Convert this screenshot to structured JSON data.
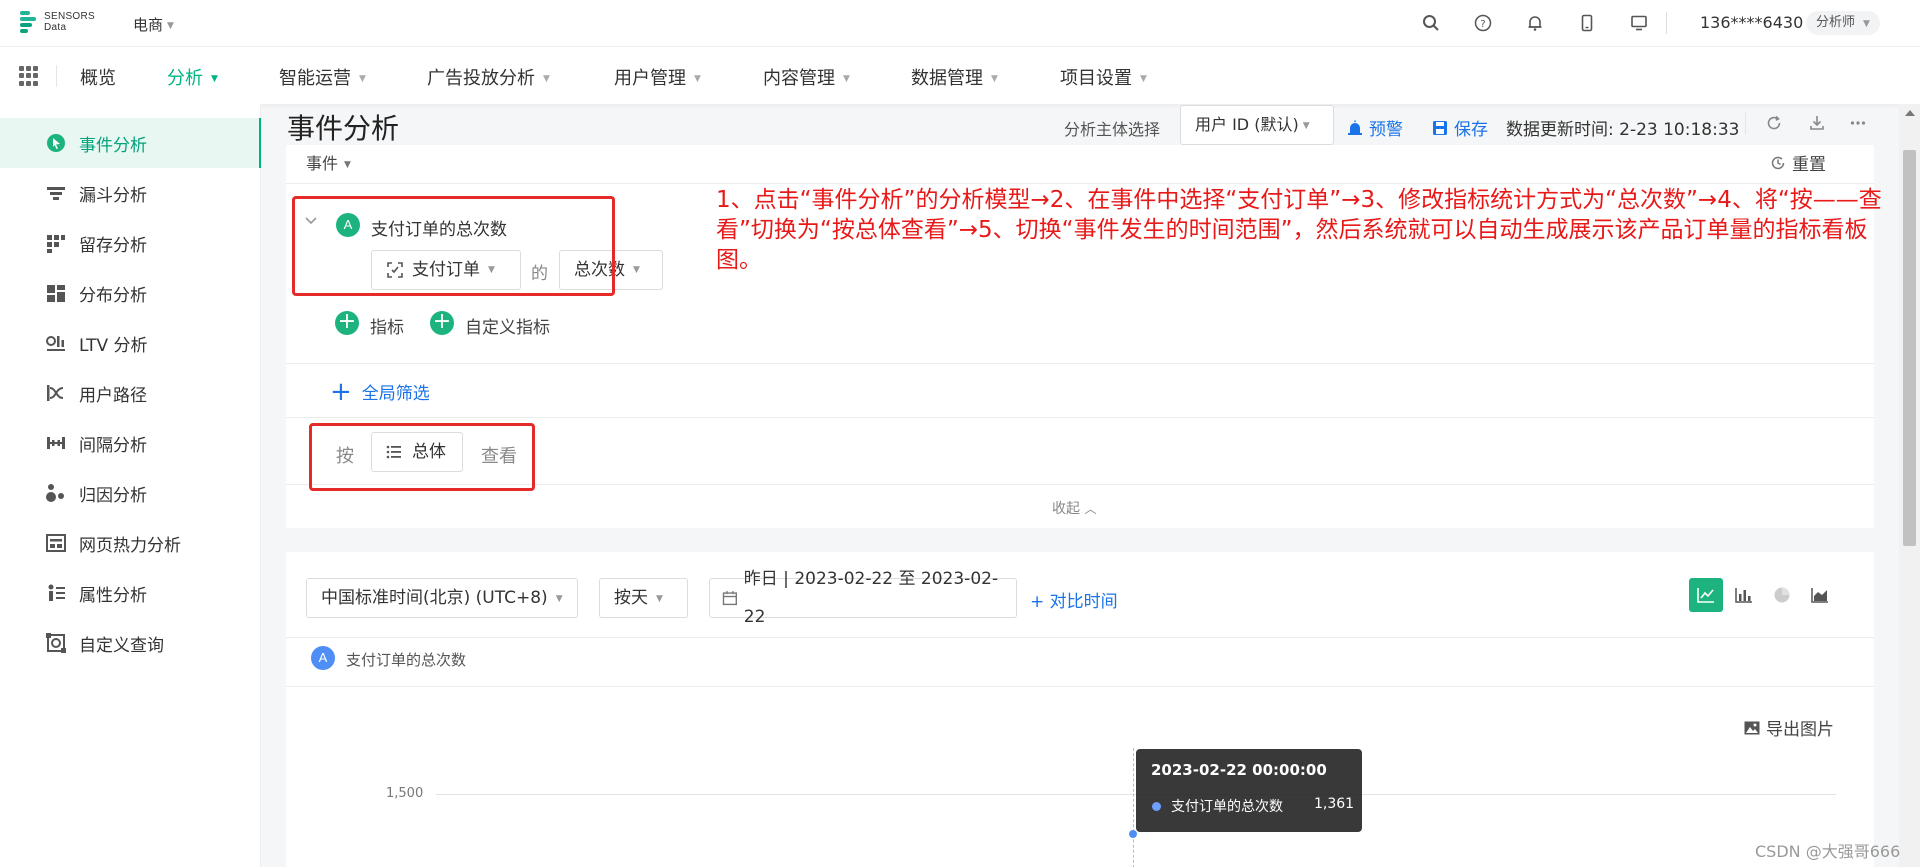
{
  "topbar": {
    "logo_line1": "SENSORS",
    "logo_line2": "Data",
    "project": "电商",
    "user_phone": "136****6430",
    "role": "分析师",
    "icons": [
      "search-icon",
      "help-icon",
      "bell-icon",
      "mobile-icon",
      "monitor-icon"
    ]
  },
  "nav": {
    "items": [
      {
        "label": "概览",
        "active": false,
        "dropdown": false
      },
      {
        "label": "分析",
        "active": true,
        "dropdown": true
      },
      {
        "label": "智能运营",
        "active": false,
        "dropdown": true
      },
      {
        "label": "广告投放分析",
        "active": false,
        "dropdown": true
      },
      {
        "label": "用户管理",
        "active": false,
        "dropdown": true
      },
      {
        "label": "内容管理",
        "active": false,
        "dropdown": true
      },
      {
        "label": "数据管理",
        "active": false,
        "dropdown": true
      },
      {
        "label": "项目设置",
        "active": false,
        "dropdown": true
      }
    ]
  },
  "sidebar": {
    "items": [
      {
        "label": "事件分析",
        "icon": "event-analysis-icon",
        "active": true
      },
      {
        "label": "漏斗分析",
        "icon": "funnel-icon",
        "active": false
      },
      {
        "label": "留存分析",
        "icon": "retention-icon",
        "active": false
      },
      {
        "label": "分布分析",
        "icon": "distribution-icon",
        "active": false
      },
      {
        "label": "LTV 分析",
        "icon": "ltv-icon",
        "active": false
      },
      {
        "label": "用户路径",
        "icon": "user-path-icon",
        "active": false
      },
      {
        "label": "间隔分析",
        "icon": "interval-icon",
        "active": false
      },
      {
        "label": "归因分析",
        "icon": "attribution-icon",
        "active": false
      },
      {
        "label": "网页热力分析",
        "icon": "heatmap-icon",
        "active": false
      },
      {
        "label": "属性分析",
        "icon": "attribute-icon",
        "active": false
      },
      {
        "label": "自定义查询",
        "icon": "custom-query-icon",
        "active": false
      }
    ]
  },
  "header": {
    "title": "事件分析",
    "subject_label": "分析主体选择",
    "subject_value": "用户 ID (默认)",
    "alert_label": "预警",
    "save_label": "保存",
    "update_time": "数据更新时间: 2-23 10:18:33"
  },
  "query": {
    "event_label": "事件",
    "reset_label": "重置",
    "metric_badge": "A",
    "metric_name": "支付订单的总次数",
    "event_select": "支付订单",
    "de_label": "的",
    "stat_select": "总次数",
    "add_metric": "指标",
    "add_custom_metric": "自定义指标",
    "global_filter": "全局筛选",
    "by_label": "按",
    "group_select": "总体",
    "view_label": "查看",
    "collapse_label": "收起"
  },
  "annotation": "1、点击“事件分析”的分析模型→2、在事件中选择“支付订单”→3、修改指标统计方式为“总次数”→4、将“按——查看”切换为“按总体查看”→5、切换“事件发生的时间范围”，然后系统就可以自动生成展示该产品订单量的指标看板图。",
  "chart_controls": {
    "timezone": "中国标准时间(北京) (UTC+8)",
    "granularity": "按天",
    "date_range": "昨日 | 2023-02-22 至 2023-02-22",
    "compare_label": "+ 对比时间",
    "chart_types": [
      "line-chart-icon",
      "bar-chart-icon",
      "pie-chart-icon",
      "area-chart-icon"
    ],
    "legend_badge": "A",
    "legend_label": "支付订单的总次数",
    "export_label": "导出图片",
    "accent_color": "#1cb37f",
    "series_color": "#4f8ef5"
  },
  "chart_data": {
    "type": "line",
    "x": [
      "2023-02-22 00:00:00"
    ],
    "series": [
      {
        "name": "支付订单的总次数",
        "values": [
          1361
        ]
      }
    ],
    "y_ticks": [
      "1,500"
    ],
    "tooltip": {
      "title": "2023-02-22 00:00:00",
      "series_name": "支付订单的总次数",
      "value": "1,361"
    }
  },
  "watermark": "CSDN @大强哥666"
}
